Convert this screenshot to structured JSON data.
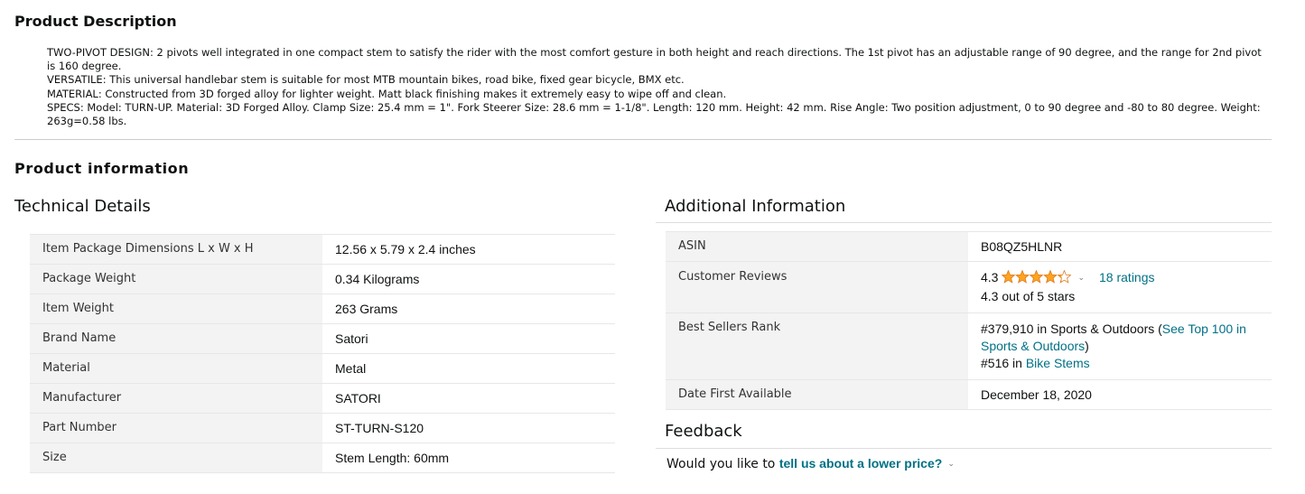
{
  "description": {
    "heading": "Product Description",
    "paragraphs": [
      "TWO-PIVOT DESIGN: 2 pivots well integrated in one compact stem to satisfy the rider with the most comfort gesture in both height and reach directions. The 1st pivot has an adjustable range of 90 degree, and the range for 2nd pivot is 160 degree.",
      "VERSATILE: This universal handlebar stem is suitable for most MTB mountain bikes, road bike, fixed gear bicycle, BMX etc.",
      "MATERIAL: Constructed from 3D forged alloy for lighter weight. Matt black finishing makes it extremely easy to wipe off and clean.",
      "SPECS: Model: TURN-UP. Material: 3D Forged Alloy. Clamp Size: 25.4 mm = 1\". Fork Steerer Size: 28.6 mm = 1-1/8\". Length: 120 mm. Height: 42 mm. Rise Angle: Two position adjustment, 0 to 90 degree and -80 to 80 degree. Weight: 263g=0.58 lbs."
    ]
  },
  "info_heading": "Product information",
  "technical": {
    "heading": "Technical Details",
    "rows": [
      {
        "label": "Item Package Dimensions L x W x H",
        "value": "12.56 x 5.79 x 2.4 inches"
      },
      {
        "label": "Package Weight",
        "value": "0.34 Kilograms"
      },
      {
        "label": "Item Weight",
        "value": "263 Grams"
      },
      {
        "label": "Brand Name",
        "value": "Satori"
      },
      {
        "label": "Material",
        "value": "Metal"
      },
      {
        "label": "Manufacturer",
        "value": "SATORI"
      },
      {
        "label": "Part Number",
        "value": "ST-TURN-S120"
      },
      {
        "label": "Size",
        "value": "Stem Length: 60mm"
      }
    ]
  },
  "additional": {
    "heading": "Additional Information",
    "asin_label": "ASIN",
    "asin_value": "B08QZ5HLNR",
    "reviews_label": "Customer Reviews",
    "rating": "4.3",
    "rating_value": 4.3,
    "ratings_count": "18 ratings",
    "rating_text": "4.3 out of 5 stars",
    "rank_label": "Best Sellers Rank",
    "rank1_prefix": "#379,910 in Sports & Outdoors (",
    "rank1_link": "See Top 100 in Sports & Outdoors",
    "rank1_suffix": ")",
    "rank2_prefix": "#516 in ",
    "rank2_link": "Bike Stems",
    "date_label": "Date First Available",
    "date_value": "December 18, 2020"
  },
  "feedback": {
    "heading": "Feedback",
    "prompt": "Would you like to ",
    "link": "tell us about a lower price?"
  },
  "colors": {
    "link": "#007185",
    "star": "#ffa41c",
    "label_bg": "#f3f3f3"
  },
  "icons": {
    "stars": "star-rating-icon",
    "caret": "chevron-down-icon"
  }
}
